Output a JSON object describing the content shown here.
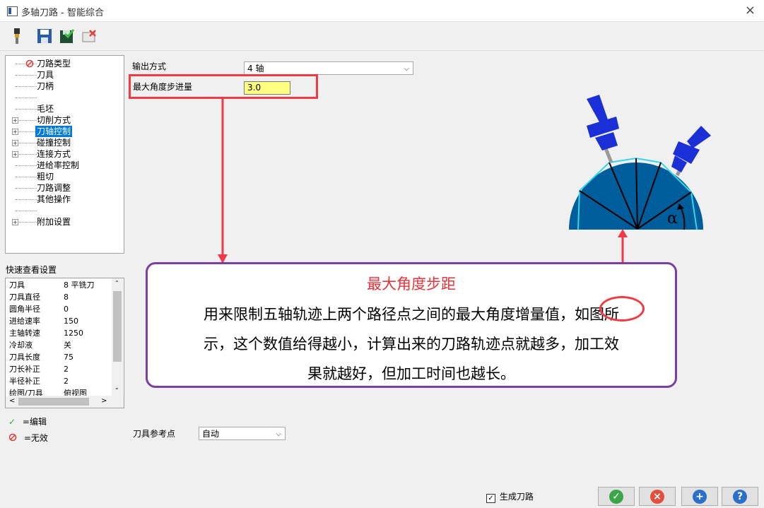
{
  "window": {
    "title": "多轴刀路 - 智能综合",
    "close_glyph": "×"
  },
  "tree": {
    "items": [
      {
        "label": "刀路类型",
        "icon": "invalid-icon"
      },
      {
        "label": "刀具"
      },
      {
        "label": "刀柄"
      },
      {
        "label": ""
      },
      {
        "label": "毛坯"
      },
      {
        "label": "切削方式",
        "expandable": true
      },
      {
        "label": "刀轴控制",
        "expandable": true,
        "selected": true
      },
      {
        "label": "碰撞控制",
        "expandable": true
      },
      {
        "label": "连接方式",
        "expandable": true
      },
      {
        "label": "进给率控制"
      },
      {
        "label": "粗切"
      },
      {
        "label": "刀路调整"
      },
      {
        "label": "其他操作"
      },
      {
        "label": ""
      },
      {
        "label": "附加设置",
        "expandable": true
      }
    ]
  },
  "quick": {
    "title": "快速查看设置",
    "rows": [
      [
        "刀具",
        "8 平铣刀"
      ],
      [
        "刀具直径",
        "8"
      ],
      [
        "圆角半径",
        "0"
      ],
      [
        "进给速率",
        "150"
      ],
      [
        "主轴转速",
        "1250"
      ],
      [
        "冷却液",
        "关"
      ],
      [
        "刀具长度",
        "75"
      ],
      [
        "刀长补正",
        "2"
      ],
      [
        "半径补正",
        "2"
      ],
      [
        "绘图/刀具",
        "俯视图"
      ]
    ]
  },
  "legend": {
    "edit": "=编辑",
    "invalid": "=无效"
  },
  "form": {
    "output_label": "输出方式",
    "output_value": "4 轴",
    "max_angle_label": "最大角度步进量",
    "max_angle_value": "3.0",
    "tool_ref_label": "刀具参考点",
    "tool_ref_value": "自动"
  },
  "callout": {
    "title": "最大角度步距",
    "line1": "用来限制五轴轨迹上两个路径点之间的最大角度增量值，如图所",
    "line2": "示，这个数值给得越小，计算出来的刀路轨迹点就越多，加工效",
    "line3": "果就越好，但加工时间也越长。"
  },
  "diagram": {
    "alpha": "α"
  },
  "footer": {
    "generate_label": "生成刀路",
    "generate_checked": true
  },
  "colors": {
    "accent_red": "#ee3b45",
    "callout_border": "#7b3fa0",
    "highlight_field": "#ffff80",
    "ok": "#3aa64a",
    "cancel": "#e0503c",
    "add": "#2b6fc8",
    "help": "#2b6fc8"
  }
}
